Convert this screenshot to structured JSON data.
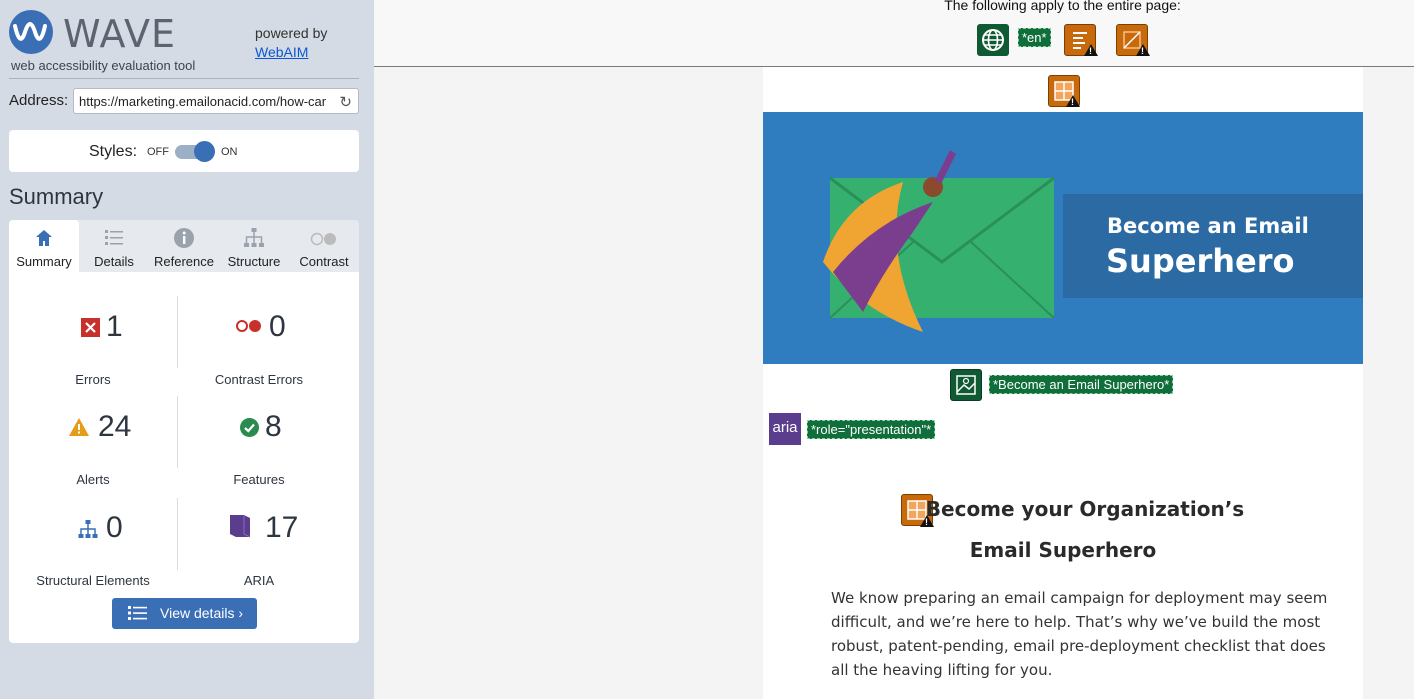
{
  "sidebar": {
    "logo_text": "WAVE",
    "logo_sub": "web accessibility evaluation tool",
    "powered_by": "powered by",
    "powered_link": "WebAIM",
    "address_label": "Address:",
    "address_value": "https://marketing.emailonacid.com/how-car",
    "styles_label": "Styles:",
    "toggle_off": "OFF",
    "toggle_on": "ON",
    "summary_heading": "Summary",
    "tabs": [
      {
        "label": "Summary",
        "icon": "home-icon"
      },
      {
        "label": "Details",
        "icon": "list-icon"
      },
      {
        "label": "Reference",
        "icon": "info-icon"
      },
      {
        "label": "Structure",
        "icon": "sitemap-icon"
      },
      {
        "label": "Contrast",
        "icon": "contrast-icon"
      }
    ],
    "stats": [
      {
        "value": "1",
        "label": "Errors",
        "icon": "error-icon",
        "color": "#c8302c"
      },
      {
        "value": "0",
        "label": "Contrast Errors",
        "icon": "contrast-error-icon",
        "color": "#c8302c"
      },
      {
        "value": "24",
        "label": "Alerts",
        "icon": "alert-icon",
        "color": "#e49c1a"
      },
      {
        "value": "8",
        "label": "Features",
        "icon": "feature-icon",
        "color": "#2a8b50"
      },
      {
        "value": "0",
        "label": "Structural Elements",
        "icon": "structure-icon",
        "color": "#3a6fb6"
      },
      {
        "value": "17",
        "label": "ARIA",
        "icon": "aria-icon",
        "color": "#5a3d8c"
      }
    ],
    "view_details": "View details ›"
  },
  "main": {
    "applies_text": "The following apply to the entire page:",
    "lang_label": "*en*",
    "hero_title_line1": "Become an Email",
    "hero_title_line2": "Superhero",
    "image_alt": "*Become an Email Superhero*",
    "aria_icon_label": "aria",
    "role_label": "*role=\"presentation\"*",
    "org_heading_line1": "Become your Organization’s",
    "org_heading_line2": "Email Superhero",
    "paragraph": "We know preparing an email campaign for deployment may seem difficult, and we’re here to help. That’s why we’ve build the most robust, patent-pending, email pre-deployment checklist that does all the heaving lifting for you."
  }
}
